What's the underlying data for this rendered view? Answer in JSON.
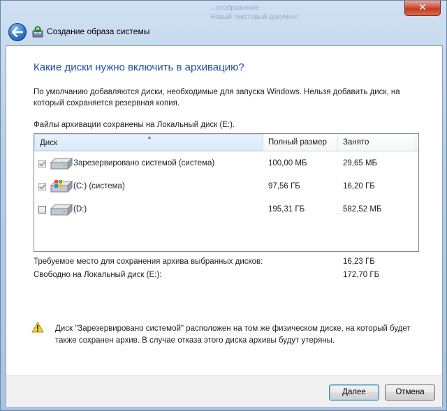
{
  "window": {
    "title": "Создание образа системы",
    "close_glyph": "✕"
  },
  "background_text": [
    "...отображение",
    "Новый текстовый документ"
  ],
  "page": {
    "heading": "Какие диски нужно включить в архивацию?",
    "description": "По умолчанию добавляются диски, необходимые для запуска Windows. Нельзя добавить диск, на который сохраняется резервная копия.",
    "files_location": "Файлы архивации сохранены на Локальный диск (E:)."
  },
  "table": {
    "columns": [
      "Диск",
      "Полный размер",
      "Занято"
    ],
    "rows": [
      {
        "name": "Зарезервировано системой (система)",
        "size": "100,00 МБ",
        "used": "29,65 МБ",
        "checked": true,
        "icon": "hard-drive-icon"
      },
      {
        "name": "(C:) (система)",
        "size": "97,56 ГБ",
        "used": "16,20 ГБ",
        "checked": true,
        "icon": "windows-drive-icon"
      },
      {
        "name": "(D:)",
        "size": "195,31 ГБ",
        "used": "582,52 МБ",
        "checked": false,
        "icon": "hard-drive-icon"
      }
    ]
  },
  "summary": {
    "required_label": "Требуемое место для сохранения архива выбранных дисков:",
    "required_value": "16,23 ГБ",
    "free_label": "Свободно на Локальный диск (E:):",
    "free_value": "172,70 ГБ"
  },
  "warning": {
    "text": "Диск \"Зарезервировано системой\" расположен на том же физическом диске, на который будет также сохранен архив. В случае отказа этого диска архивы будут утеряны."
  },
  "buttons": {
    "next": "Далее",
    "cancel": "Отмена"
  }
}
